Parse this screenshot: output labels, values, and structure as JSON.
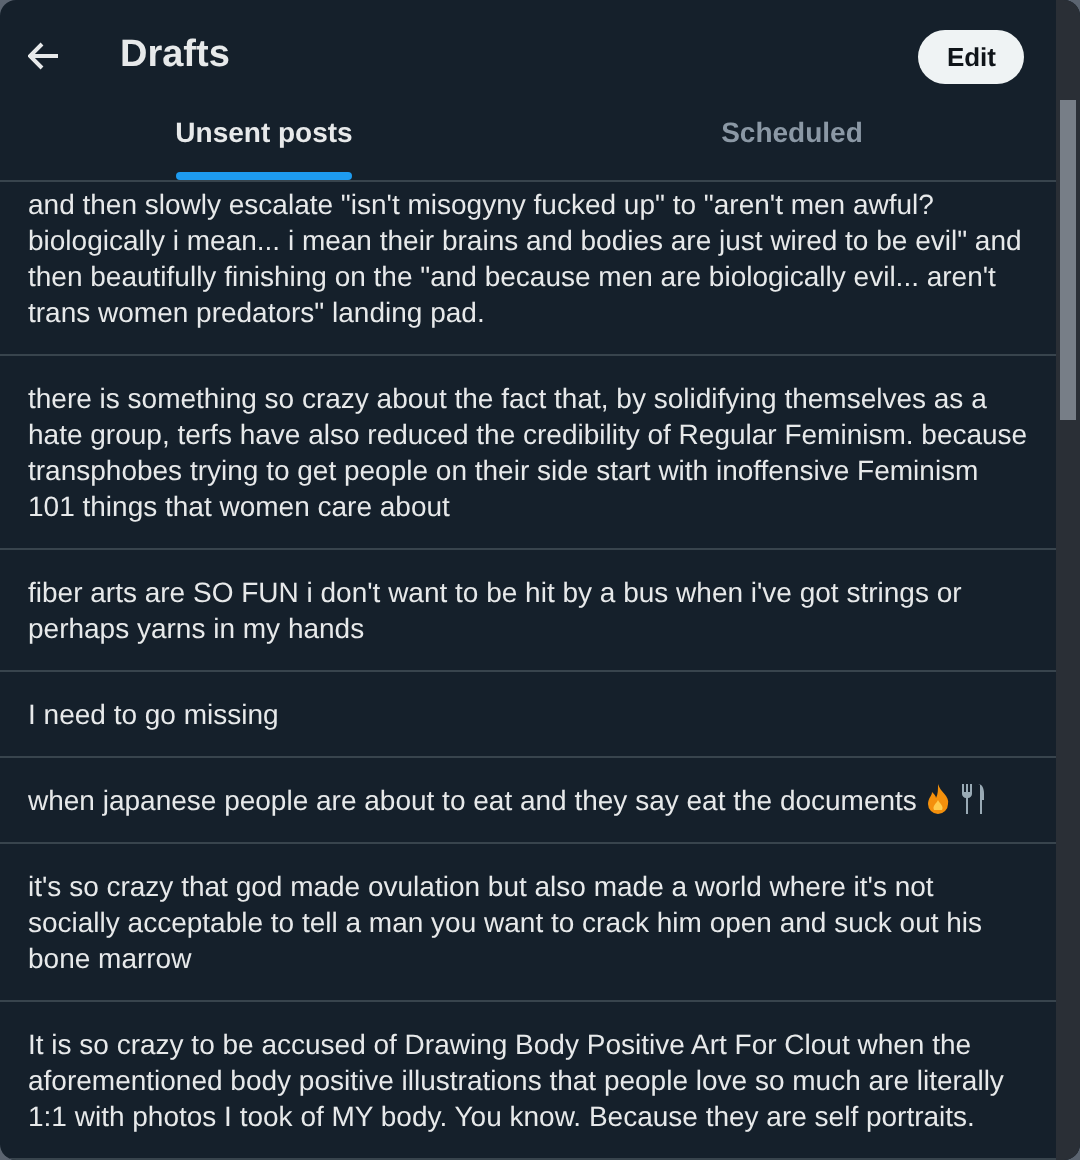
{
  "header": {
    "title": "Drafts",
    "edit_button": "Edit"
  },
  "tabs": [
    {
      "label": "Unsent posts",
      "selected": true
    },
    {
      "label": "Scheduled",
      "selected": false
    }
  ],
  "drafts": [
    {
      "text": "and then slowly escalate \"isn't misogyny fucked up\" to \"aren't men awful? biologically i mean... i mean their brains and bodies are just wired to be evil\" and then beautifully finishing on the \"and because men are biologically evil... aren't trans women predators\" landing pad."
    },
    {
      "text": "there is something so crazy about the fact that, by solidifying themselves as a hate group, terfs have also reduced the credibility of Regular Feminism. because transphobes trying to get people on their side start with inoffensive Feminism 101 things that women care about"
    },
    {
      "text": "fiber arts are SO FUN i don't want to be hit by a bus when i've got strings or perhaps yarns in my hands"
    },
    {
      "text": "I need to go missing"
    },
    {
      "text": "when japanese people are about to eat and they say eat the documents",
      "emoji": true
    },
    {
      "text": "it's so crazy that god made ovulation but also made a world where it's not socially acceptable to tell a man you want to crack him open and suck out his bone marrow"
    },
    {
      "text": "It is so crazy to be accused of Drawing Body Positive Art For Clout when the aforementioned body positive illustrations that people love so much are literally 1:1 with photos I took of MY body. You know. Because they are self portraits."
    }
  ]
}
